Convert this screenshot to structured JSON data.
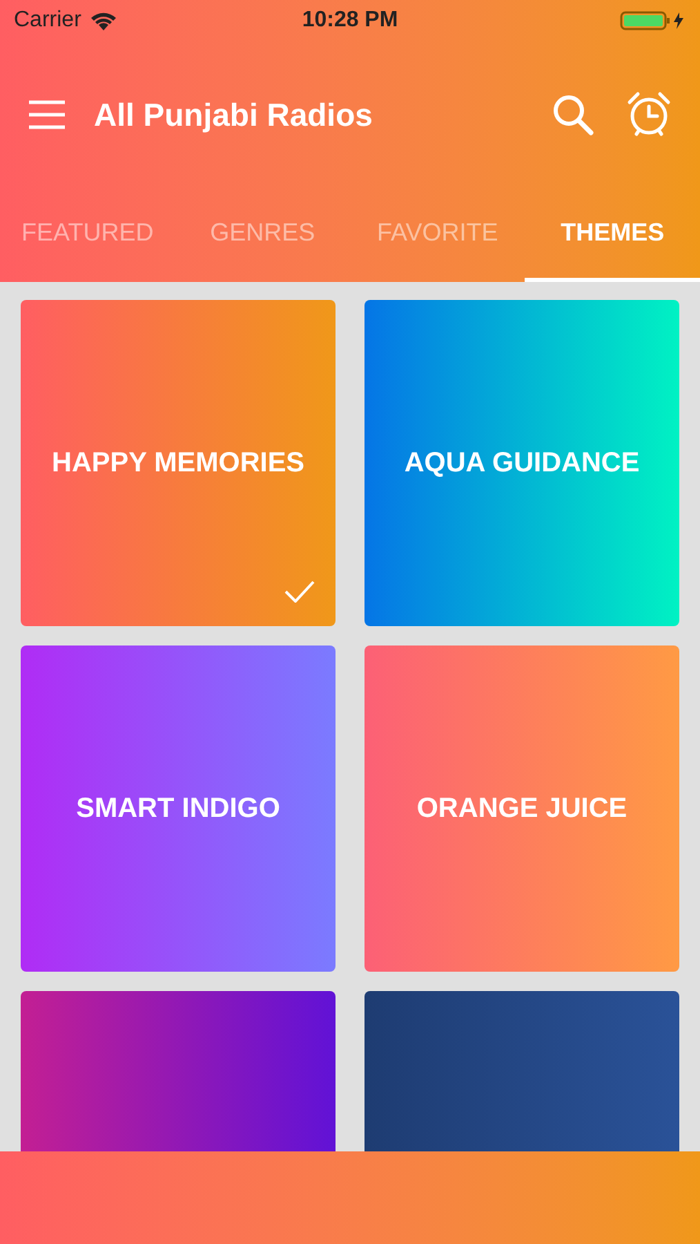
{
  "status_bar": {
    "carrier": "Carrier",
    "time": "10:28 PM"
  },
  "app_bar": {
    "title": "All Punjabi Radios"
  },
  "tabs": [
    {
      "label": "FEATURED",
      "selected": false
    },
    {
      "label": "GENRES",
      "selected": false
    },
    {
      "label": "FAVORITE",
      "selected": false
    },
    {
      "label": "THEMES",
      "selected": true
    }
  ],
  "themes": [
    {
      "name": "HAPPY MEMORIES",
      "color": "#ff5e62",
      "selected": true
    },
    {
      "name": "AQUA GUIDANCE",
      "color": "#0575e6",
      "selected": false
    },
    {
      "name": "SMART INDIGO",
      "color": "#b02cf5",
      "selected": false
    },
    {
      "name": "ORANGE JUICE",
      "color": "#fc6076",
      "selected": false
    },
    {
      "color": "#c31f93"
    },
    {
      "color": "#1e3c72"
    }
  ]
}
